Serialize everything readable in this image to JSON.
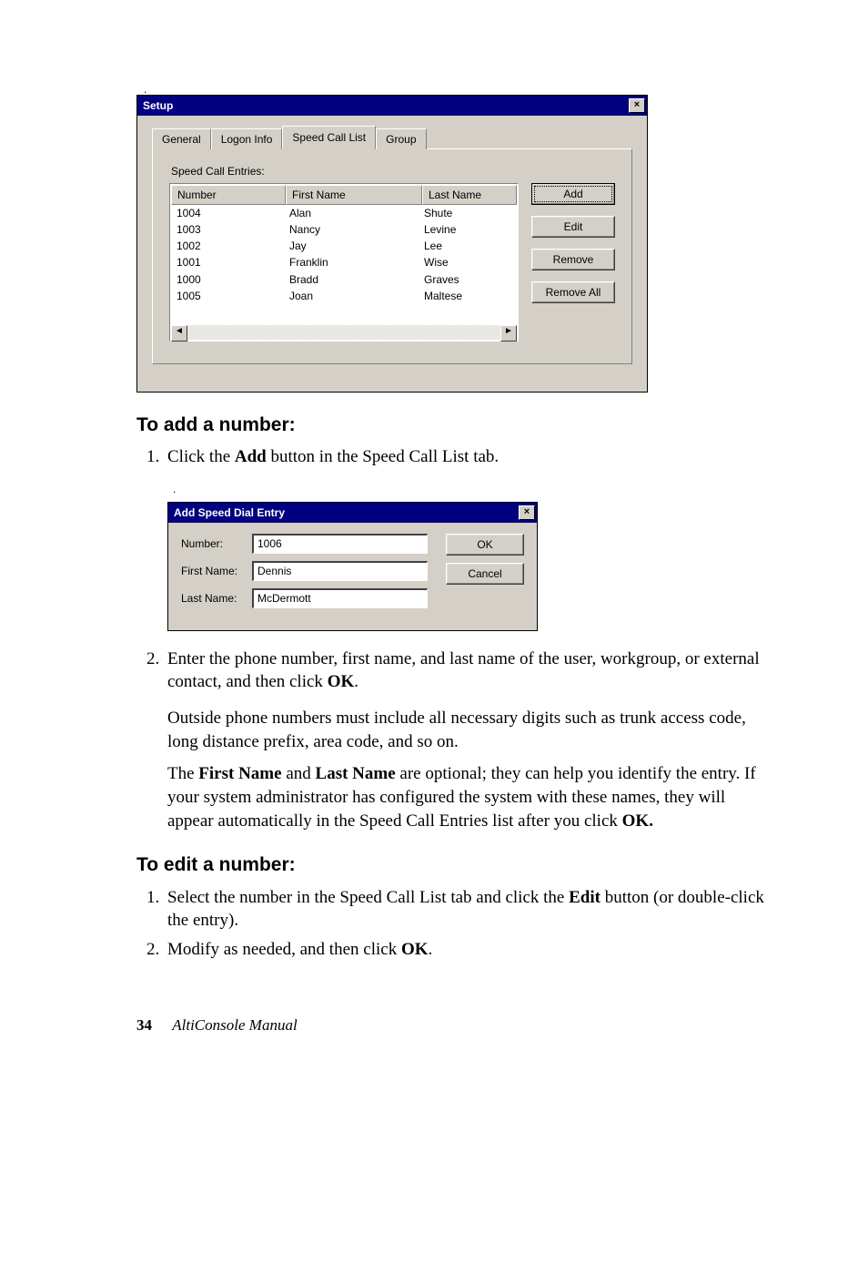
{
  "setup_dialog": {
    "title": "Setup",
    "close_label": "×",
    "tabs": [
      "General",
      "Logon Info",
      "Speed Call List",
      "Group"
    ],
    "active_tab_index": 2,
    "entries_label": "Speed Call Entries:",
    "columns": [
      "Number",
      "First Name",
      "Last Name"
    ],
    "rows": [
      {
        "number": "1004",
        "first": "Alan",
        "last": "Shute"
      },
      {
        "number": "1003",
        "first": "Nancy",
        "last": "Levine"
      },
      {
        "number": "1002",
        "first": "Jay",
        "last": "Lee"
      },
      {
        "number": "1001",
        "first": "Franklin",
        "last": "Wise"
      },
      {
        "number": "1000",
        "first": "Bradd",
        "last": "Graves"
      },
      {
        "number": "1005",
        "first": "Joan",
        "last": "Maltese"
      }
    ],
    "buttons": {
      "add": "Add",
      "edit": "Edit",
      "remove": "Remove",
      "remove_all": "Remove All"
    },
    "scroll_left": "◄",
    "scroll_right": "►"
  },
  "doc": {
    "heading_add": "To add a number:",
    "step_add_pre": "Click the ",
    "step_add_bold": "Add",
    "step_add_post": " button in the Speed Call List tab.",
    "step2_pre": "Enter the phone number, first name, and last name of the user, workgroup, or external contact, and then click ",
    "step2_bold": "OK",
    "step2_post": ".",
    "note1": "Outside phone numbers must include all necessary digits such as trunk access code, long distance prefix, area code, and so on.",
    "note2_pre": "The ",
    "note2_b1": "First Name",
    "note2_mid1": " and ",
    "note2_b2": "Last Name",
    "note2_mid2": " are optional; they can help you identify the entry. If your system administrator has configured the system with these names, they will appear automatically in the Speed Call Entries list after you click ",
    "note2_b3": "OK.",
    "heading_edit": "To edit a number:",
    "edit1_pre": "Select the number in the Speed Call List tab and click the ",
    "edit1_bold": "Edit",
    "edit1_post": " button (or double-click the entry).",
    "edit2_pre": "Modify as needed, and then click ",
    "edit2_bold": "OK",
    "edit2_post": "."
  },
  "add_dialog": {
    "title": "Add Speed Dial Entry",
    "close_label": "×",
    "labels": {
      "number": "Number:",
      "first": "First Name:",
      "last": "Last Name:"
    },
    "values": {
      "number": "1006",
      "first": "Dennis",
      "last": "McDermott"
    },
    "buttons": {
      "ok": "OK",
      "cancel": "Cancel"
    }
  },
  "footer": {
    "page": "34",
    "manual": "AltiConsole Manual"
  }
}
